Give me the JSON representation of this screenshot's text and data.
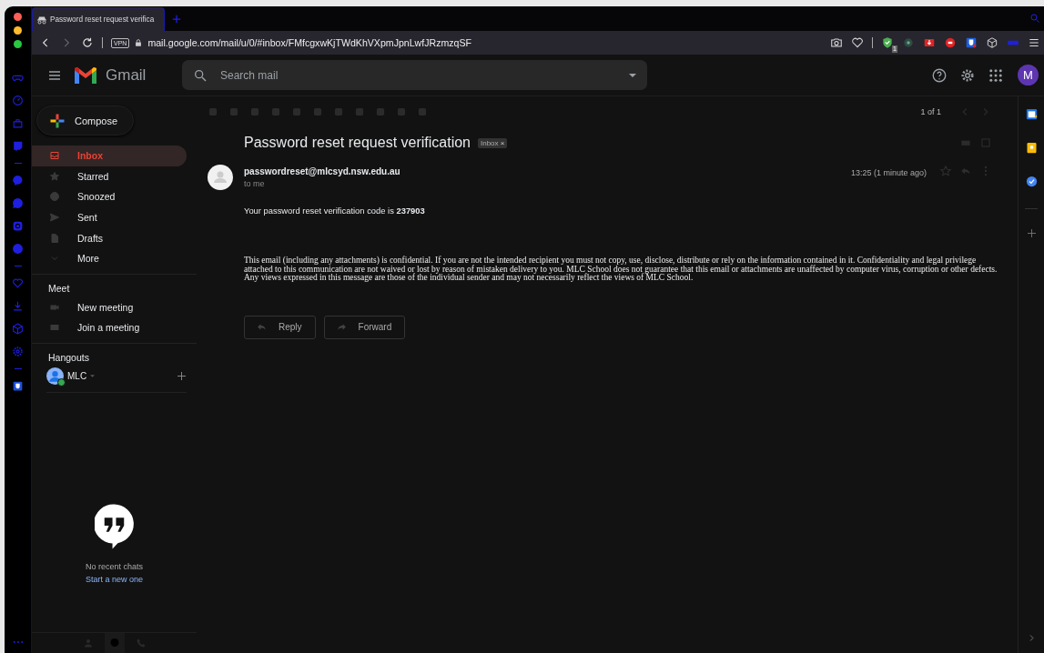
{
  "browser": {
    "tab_title": "Password reset request verifica",
    "url": "mail.google.com/mail/u/0/#inbox/FMfcgxwKjTWdKhVXpmJpnLwfJRzmzqSF",
    "vpn_badge": "VPN",
    "extension_badge": "1"
  },
  "header": {
    "app_name": "Gmail",
    "search": {
      "placeholder": "Search mail"
    },
    "avatar": "M"
  },
  "nav": {
    "compose": "Compose",
    "items": [
      {
        "label": "Inbox",
        "selected": true
      },
      {
        "label": "Starred",
        "selected": false
      },
      {
        "label": "Snoozed",
        "selected": false
      },
      {
        "label": "Sent",
        "selected": false
      },
      {
        "label": "Drafts",
        "selected": false
      },
      {
        "label": "More",
        "selected": false
      }
    ],
    "meet": {
      "title": "Meet",
      "items": [
        "New meeting",
        "Join a meeting"
      ]
    },
    "hangouts": {
      "title": "Hangouts",
      "user": {
        "name": "MLC",
        "online": true
      },
      "empty_text": "No recent chats",
      "start_link": "Start a new one"
    }
  },
  "toolbar": {
    "pager": "1 of 1"
  },
  "message": {
    "subject": "Password reset request verification",
    "label": "Inbox",
    "label_close": "×",
    "sender": "passwordreset@mlcsyd.nsw.edu.au",
    "recipient": "to me",
    "time": "13:25 (1 minute ago)",
    "body": "Your password reset verification code is **237903**",
    "disclaimer": "This email (including any attachments) is confidential. If you are not the intended recipient you must not copy, use, disclose, distribute or rely on the information contained in it. Confidentiality and legal privilege attached to this communication are not waived or lost by reason of mistaken delivery to you. MLC School does not guarantee that this email or attachments are unaffected by computer virus, corruption or other defects. Any views expressed in this message are those of the individual sender and may not necessarily reflect the views of MLC School.",
    "actions": [
      "Reply",
      "Forward"
    ]
  }
}
